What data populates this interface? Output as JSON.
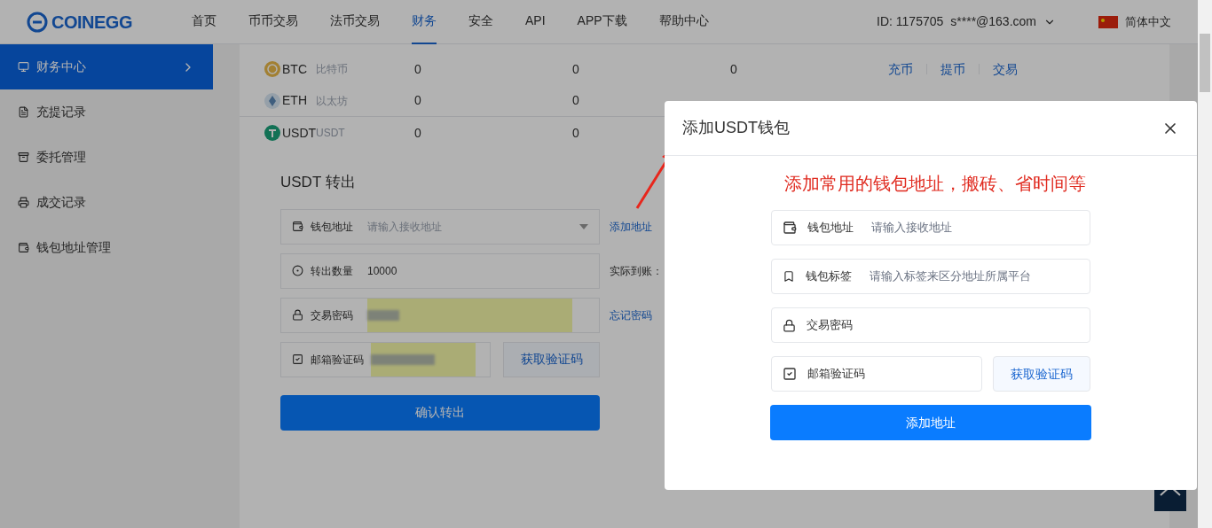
{
  "header": {
    "logo": "COINEGG",
    "nav": [
      {
        "label": "首页",
        "selected": false
      },
      {
        "label": "币币交易",
        "selected": false
      },
      {
        "label": "法币交易",
        "selected": false
      },
      {
        "label": "财务",
        "selected": true
      },
      {
        "label": "安全",
        "selected": false
      },
      {
        "label": "API",
        "selected": false
      },
      {
        "label": "APP下载",
        "selected": false
      },
      {
        "label": "帮助中心",
        "selected": false
      }
    ],
    "user_id": "ID: 1175705",
    "email": "s****@163.com",
    "language": "简体中文"
  },
  "sidebar": {
    "items": [
      {
        "label": "财务中心",
        "selected": true
      },
      {
        "label": "充提记录",
        "selected": false
      },
      {
        "label": "委托管理",
        "selected": false
      },
      {
        "label": "成交记录",
        "selected": false
      },
      {
        "label": "钱包地址管理",
        "selected": false
      }
    ]
  },
  "assets": [
    {
      "kind": "btc",
      "symbol": "BTC",
      "name": "比特币",
      "values": [
        "0",
        "0",
        "0"
      ],
      "actions": [
        "充币",
        "提币",
        "交易"
      ]
    },
    {
      "kind": "eth",
      "symbol": "ETH",
      "name": "以太坊",
      "values": [
        "0",
        "0"
      ]
    },
    {
      "kind": "usdt",
      "symbol": "USDT",
      "name": "USDT",
      "values": [
        "0",
        "0"
      ]
    }
  ],
  "transfer": {
    "title": "USDT 转出",
    "address_label": "钱包地址",
    "address_placeholder": "请输入接收地址",
    "add_address_link": "添加地址",
    "amount_label": "转出数量",
    "amount_value": "10000",
    "actual_label": "实际到账：",
    "password_label": "交易密码",
    "forgot_link": "忘记密码",
    "code_label": "邮箱验证码",
    "get_code_button": "获取验证码",
    "submit_button": "确认转出"
  },
  "modal": {
    "title": "添加USDT钱包",
    "note": "添加常用的钱包地址，搬砖、省时间等",
    "address_label": "钱包地址",
    "address_placeholder": "请输入接收地址",
    "tag_label": "钱包标签",
    "tag_placeholder": "请输入标签来区分地址所属平台",
    "password_label": "交易密码",
    "code_label": "邮箱验证码",
    "get_code_button": "获取验证码",
    "submit_button": "添加地址"
  }
}
